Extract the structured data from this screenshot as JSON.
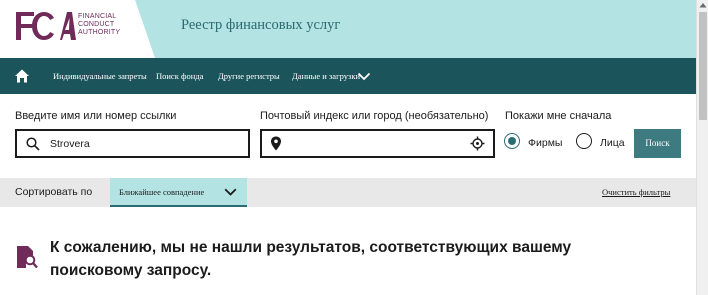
{
  "header": {
    "logo_letters": "FCA",
    "logo_lines": [
      "FINANCIAL",
      "CONDUCT",
      "AUTHORITY"
    ],
    "registry_title": "Реестр финансовых услуг"
  },
  "nav": {
    "home_icon": "home-icon",
    "items": [
      {
        "label": "Индивидуальные запреты"
      },
      {
        "label": "Поиск фонда"
      },
      {
        "label": "Другие регистры"
      },
      {
        "label": "Данные и загрузки"
      }
    ]
  },
  "search": {
    "name_label": "Введите имя или номер ссылки",
    "name_value": "Strovera",
    "location_label": "Почтовый индекс или город (необязательно)",
    "location_value": "",
    "show_first_label": "Покажи мне сначала",
    "options": [
      {
        "label": "Фирмы",
        "checked": true
      },
      {
        "label": "Лица",
        "checked": false
      }
    ],
    "search_button": "Поиск"
  },
  "sort": {
    "label": "Сортировать по",
    "selected": "Ближайшее совпадение",
    "clear_filters": "Очистить фильтры"
  },
  "results": {
    "no_results_message": "К сожалению, мы не нашли результатов, соответствующих вашему поисковому запросу."
  },
  "colors": {
    "brand_purple": "#702b5a",
    "header_teal_light": "#b4e3e3",
    "nav_teal_dark": "#1c545b",
    "button_teal": "#3d7b80",
    "text_dark": "#1b1b1b"
  }
}
